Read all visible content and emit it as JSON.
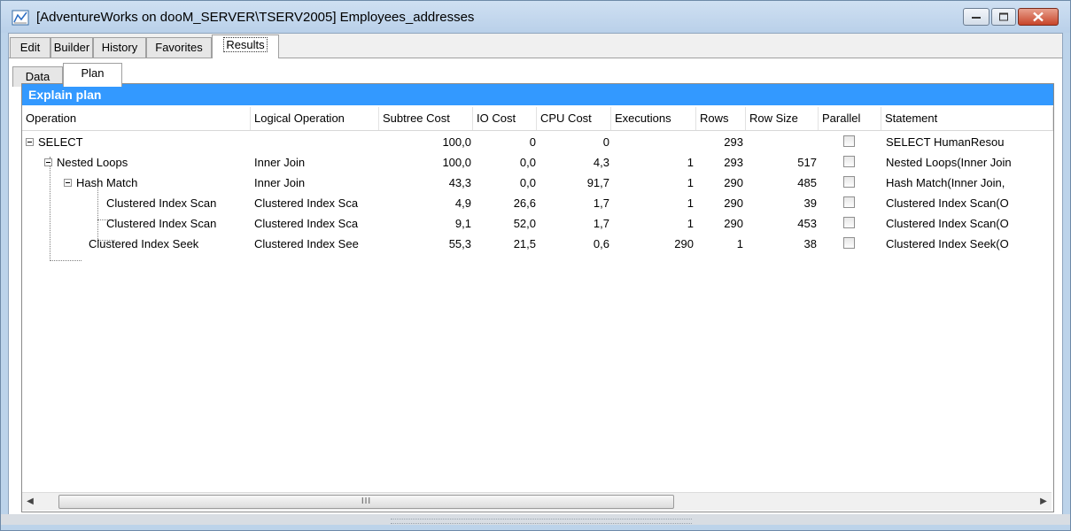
{
  "window": {
    "title": "[AdventureWorks on dooM_SERVER\\TSERV2005] Employees_addresses"
  },
  "tabs": [
    "Edit",
    "Builder",
    "History",
    "Favorites",
    "Results"
  ],
  "active_tab": "Results",
  "subtabs": [
    "Data",
    "Plan"
  ],
  "active_subtab": "Plan",
  "grid": {
    "title": "Explain plan",
    "columns": [
      "Operation",
      "Logical Operation",
      "Subtree Cost",
      "IO Cost",
      "CPU Cost",
      "Executions",
      "Rows",
      "Row Size",
      "Parallel",
      "Statement"
    ],
    "rows": [
      {
        "operation": "SELECT",
        "logical": "",
        "subtree": "100,0",
        "io": "0",
        "cpu": "0",
        "executions": "",
        "rows": "293",
        "rowsize": "",
        "parallel": false,
        "statement": "SELECT   HumanResou"
      },
      {
        "operation": "Nested Loops",
        "logical": "Inner Join",
        "subtree": "100,0",
        "io": "0,0",
        "cpu": "4,3",
        "executions": "1",
        "rows": "293",
        "rowsize": "517",
        "parallel": false,
        "statement": "Nested Loops(Inner Join"
      },
      {
        "operation": "Hash Match",
        "logical": "Inner Join",
        "subtree": "43,3",
        "io": "0,0",
        "cpu": "91,7",
        "executions": "1",
        "rows": "290",
        "rowsize": "485",
        "parallel": false,
        "statement": "Hash Match(Inner Join,"
      },
      {
        "operation": "Clustered Index Scan",
        "logical": "Clustered Index Sca",
        "subtree": "4,9",
        "io": "26,6",
        "cpu": "1,7",
        "executions": "1",
        "rows": "290",
        "rowsize": "39",
        "parallel": false,
        "statement": "Clustered Index Scan(O"
      },
      {
        "operation": "Clustered Index Scan",
        "logical": "Clustered Index Sca",
        "subtree": "9,1",
        "io": "52,0",
        "cpu": "1,7",
        "executions": "1",
        "rows": "290",
        "rowsize": "453",
        "parallel": false,
        "statement": "Clustered Index Scan(O"
      },
      {
        "operation": "Clustered Index Seek",
        "logical": "Clustered Index See",
        "subtree": "55,3",
        "io": "21,5",
        "cpu": "0,6",
        "executions": "290",
        "rows": "1",
        "rowsize": "38",
        "parallel": false,
        "statement": "Clustered Index Seek(O"
      }
    ]
  },
  "scrollbar": {
    "grip": "III"
  },
  "colors": {
    "accent": "#3399ff",
    "title_bg": "#c5daf0",
    "close": "#c8462a"
  },
  "icons": {
    "app": "query-plan-icon",
    "minimize": "minimize-icon",
    "maximize": "maximize-icon",
    "close": "close-icon"
  }
}
